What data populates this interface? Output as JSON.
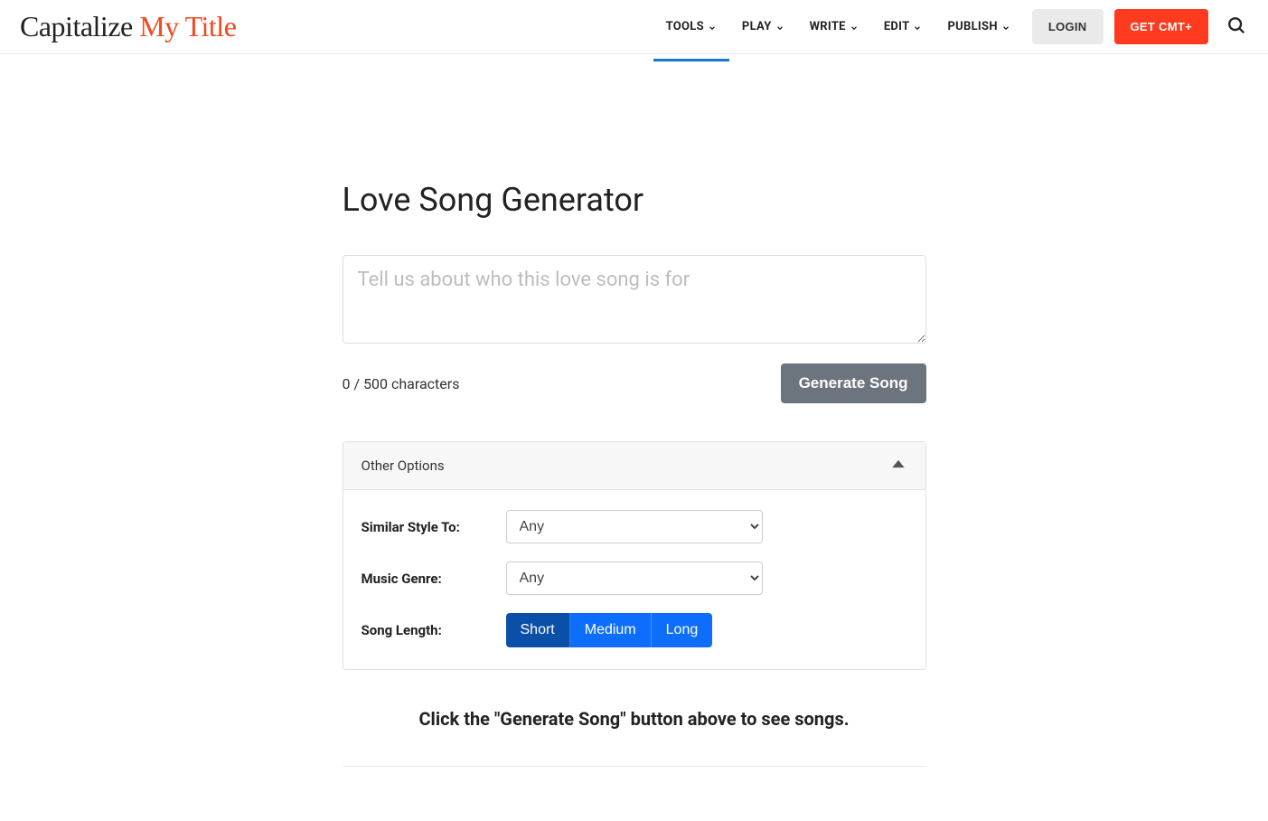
{
  "header": {
    "logo": {
      "part1": "Capitalize ",
      "part2": "My Title"
    },
    "nav": [
      {
        "label": "TOOLS",
        "active": true
      },
      {
        "label": "PLAY",
        "active": false
      },
      {
        "label": "WRITE",
        "active": false
      },
      {
        "label": "EDIT",
        "active": false
      },
      {
        "label": "PUBLISH",
        "active": false
      }
    ],
    "login_label": "LOGIN",
    "cta_label": "GET CMT+"
  },
  "main": {
    "title": "Love Song Generator",
    "prompt_placeholder": "Tell us about who this love song is for",
    "prompt_value": "",
    "char_count": "0 / 500 characters",
    "generate_label": "Generate Song",
    "options": {
      "header_label": "Other Options",
      "style_label": "Similar Style To:",
      "style_value": "Any",
      "genre_label": "Music Genre:",
      "genre_value": "Any",
      "length_label": "Song Length:",
      "lengths": [
        {
          "label": "Short",
          "selected": true
        },
        {
          "label": "Medium",
          "selected": false
        },
        {
          "label": "Long",
          "selected": false
        }
      ]
    },
    "hint": "Click the \"Generate Song\" button above to see songs."
  }
}
